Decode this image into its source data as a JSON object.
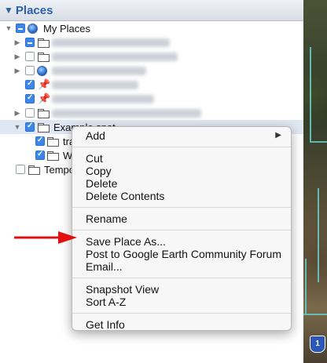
{
  "places": {
    "title": "Places",
    "root_label": "My Places",
    "example_label": "Example spot",
    "child1_label": "tra",
    "child2_label": "W",
    "temp_label": "Tempo"
  },
  "menu": {
    "add": "Add",
    "cut": "Cut",
    "copy": "Copy",
    "delete": "Delete",
    "delete_contents": "Delete Contents",
    "rename": "Rename",
    "save_place_as": "Save Place As...",
    "post_forum": "Post to Google Earth Community Forum",
    "email": "Email...",
    "snapshot_view": "Snapshot View",
    "sort_az": "Sort A-Z",
    "get_info": "Get Info",
    "submenu_icon": "triangle-right-icon"
  },
  "map": {
    "shield_text": "1"
  },
  "colors": {
    "accent": "#2b5fa8",
    "arrow": "#e01010",
    "checkbox": "#3b86e8"
  }
}
